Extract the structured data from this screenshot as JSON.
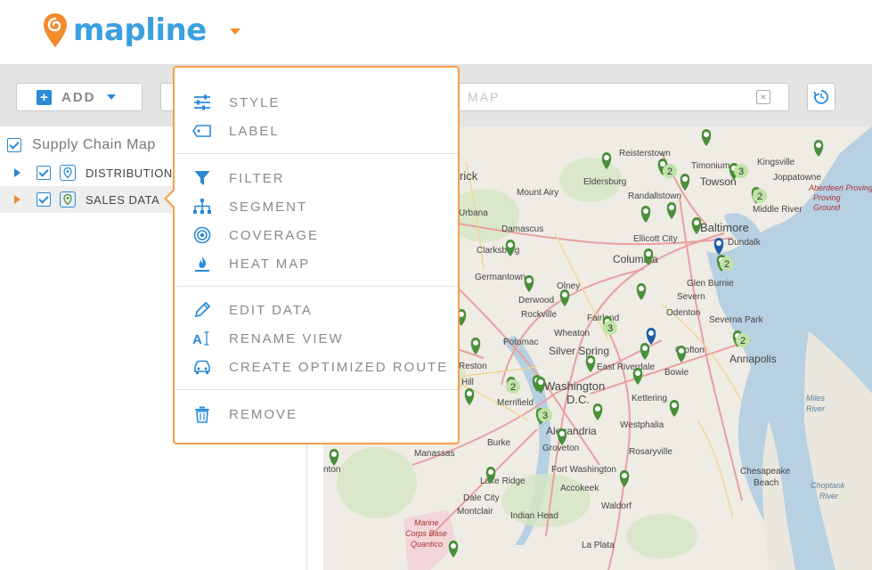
{
  "header": {
    "logo_text": "mapline"
  },
  "toolbar": {
    "add_label": "ADD",
    "search_text": "MAP",
    "clear_symbol": "×"
  },
  "sidebar": {
    "root_label": "Supply Chain Map",
    "layers": [
      {
        "label": "DISTRIBUTION",
        "expander": "blue"
      },
      {
        "label": "SALES DATA",
        "expander": "orange",
        "selected": true
      }
    ]
  },
  "menu": {
    "groups": [
      [
        {
          "label": "STYLE",
          "icon": "sliders-icon"
        },
        {
          "label": "LABEL",
          "icon": "tag-icon"
        }
      ],
      [
        {
          "label": "FILTER",
          "icon": "funnel-icon"
        },
        {
          "label": "SEGMENT",
          "icon": "hierarchy-icon"
        },
        {
          "label": "COVERAGE",
          "icon": "target-icon"
        },
        {
          "label": "HEAT MAP",
          "icon": "flame-icon"
        }
      ],
      [
        {
          "label": "EDIT DATA",
          "icon": "pencil-icon"
        },
        {
          "label": "RENAME VIEW",
          "icon": "rename-text-icon"
        },
        {
          "label": "CREATE OPTIMIZED ROUTE",
          "icon": "car-route-icon"
        }
      ],
      [
        {
          "label": "REMOVE",
          "icon": "trash-icon"
        }
      ]
    ]
  },
  "map": {
    "labels": [
      "Reisterstown",
      "Timonium",
      "Kingsville",
      "Eldersburg",
      "Towson",
      "Joppatowne",
      "Randallstown",
      "Aberdeen Proving Ground",
      "Middle River",
      "Baltimore",
      "Dundalk",
      "Ellicott City",
      "Damascus",
      "Clarksburg",
      "Columbia",
      "Glen Burnie",
      "Germantown",
      "Olney",
      "Derwood",
      "Rockville",
      "Severn",
      "Odenton",
      "Fairland",
      "Wheaton",
      "Severna Park",
      "Potomac",
      "Silver Spring",
      "Crofton",
      "Annapolis",
      "Reston",
      "Washington D.C.",
      "East Riverdale",
      "Bowie",
      "Kettering",
      "Merrifield",
      "Westphalia",
      "Alexandria",
      "Burke",
      "Manassas",
      "Groveton",
      "Rosaryville",
      "Fort Washington",
      "Chesapeake Beach",
      "Lake Ridge",
      "Accokeek",
      "Dale City",
      "Montclair",
      "Waldorf",
      "Indian Head",
      "Marine Corps Base Quantico",
      "La Plata",
      "Miles River",
      "Choptank River",
      "Mount Airy",
      "Urbana",
      "rick",
      "nton",
      "Hill"
    ],
    "clusters": [
      "2",
      "3",
      "2",
      "2",
      "3",
      "2",
      "2",
      "3"
    ],
    "accent": "#f28b2c",
    "pin_green": "#4a8f3c",
    "pin_blue": "#1f5fa8"
  }
}
